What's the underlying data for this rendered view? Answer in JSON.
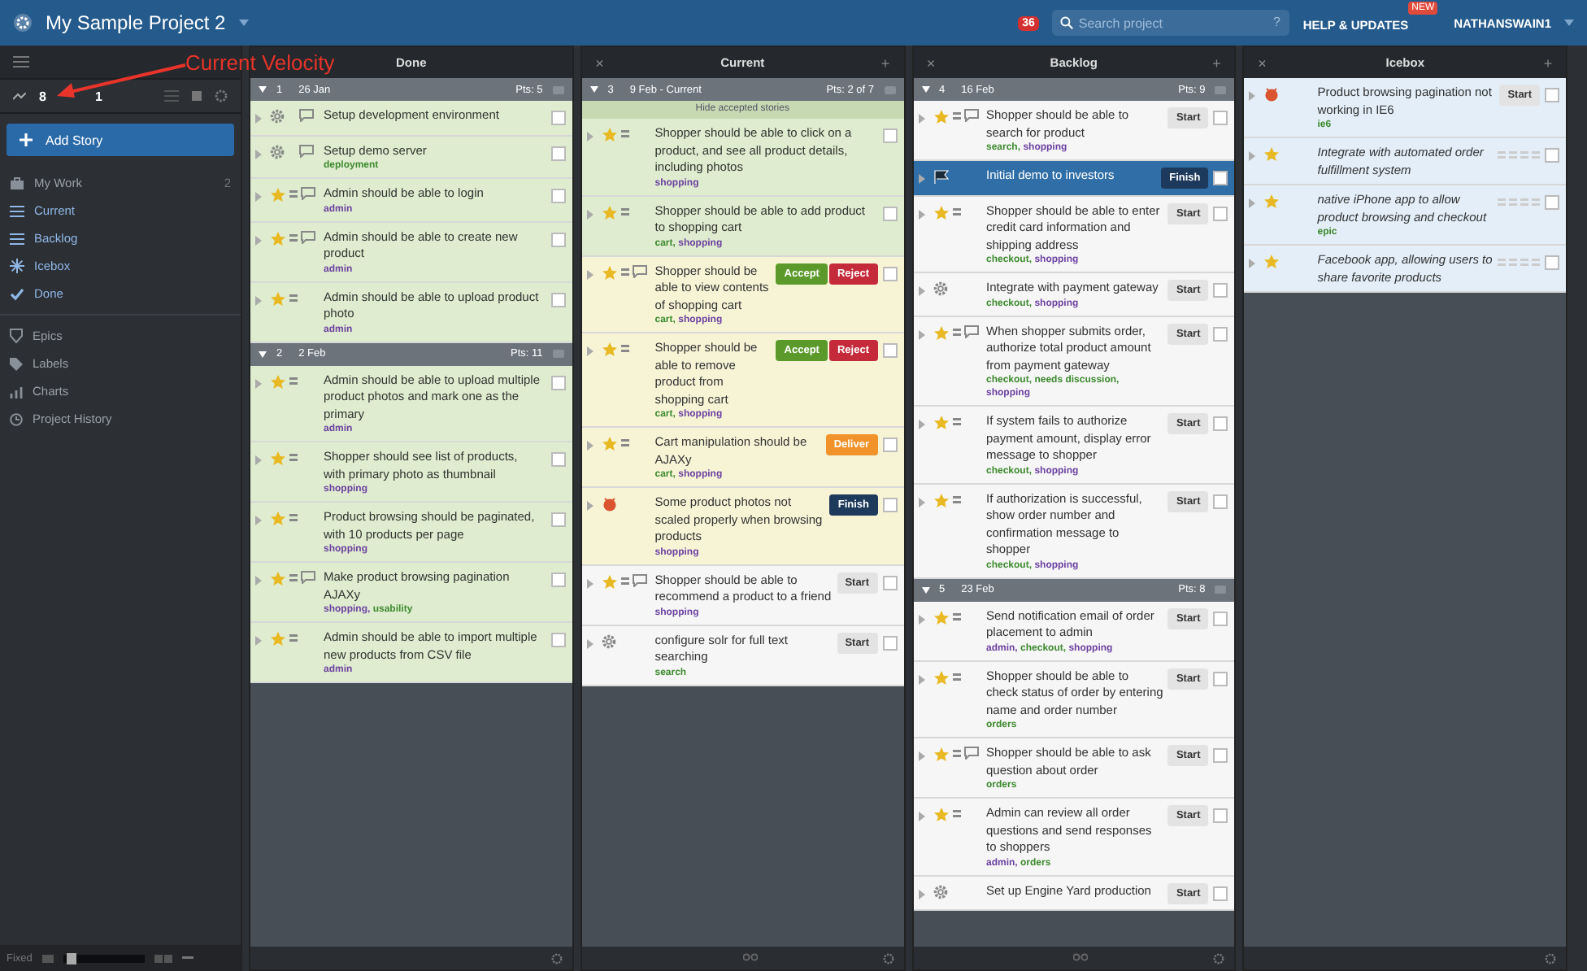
{
  "header": {
    "project": "My Sample Project 2",
    "notifications": "36",
    "search": {
      "placeholder": "Search project"
    },
    "help_key": "?",
    "help": "HELP & UPDATES",
    "help_badge": "NEW",
    "user": "NATHANSWAIN1"
  },
  "annotation": {
    "text": "Current Velocity"
  },
  "sidebar": {
    "velocity": "8",
    "velocity_2": "1",
    "add_story": "Add Story",
    "items": [
      {
        "label": "My Work",
        "count": "2",
        "open": false
      },
      {
        "label": "Current",
        "open": true
      },
      {
        "label": "Backlog",
        "open": true
      },
      {
        "label": "Icebox",
        "open": true
      },
      {
        "label": "Done",
        "open": true
      }
    ],
    "items_2": [
      {
        "label": "Epics"
      },
      {
        "label": "Labels"
      },
      {
        "label": "Charts"
      },
      {
        "label": "Project History"
      }
    ],
    "footer": {
      "mode": "Fixed",
      "zoom": {
        "level": 0.05
      }
    }
  },
  "columns": [
    {
      "title": "Done",
      "reorder": false,
      "groups": [
        {
          "number": "1",
          "date": "26 Jan",
          "points": "Pts: 5",
          "stories": [
            {
              "kind": "chore",
              "color": "#dfeccf",
              "comments": true,
              "title": "Setup development environment"
            },
            {
              "kind": "chore",
              "color": "#dfeccf",
              "comments": true,
              "title": "Setup demo server",
              "labels": [
                {
                  "name": "deployment",
                  "color": "#3d8b2f"
                }
              ]
            },
            {
              "kind": "feature",
              "estimated": true,
              "color": "#dfeccf",
              "comments": true,
              "title": "Admin should be able to login",
              "labels": [
                {
                  "name": "admin",
                  "color": "#6b3fa0"
                }
              ]
            },
            {
              "kind": "feature",
              "estimated": true,
              "color": "#dfeccf",
              "comments": true,
              "title": "Admin should be able to create new product",
              "labels": [
                {
                  "name": "admin",
                  "color": "#6b3fa0"
                }
              ]
            },
            {
              "kind": "feature",
              "estimated": true,
              "color": "#dfeccf",
              "comments": false,
              "title": "Admin should be able to upload product photo",
              "labels": [
                {
                  "name": "admin",
                  "color": "#6b3fa0"
                }
              ]
            }
          ]
        },
        {
          "number": "2",
          "date": "2 Feb",
          "points": "Pts: 11",
          "stories": [
            {
              "kind": "feature",
              "estimated": true,
              "color": "#dfeccf",
              "comments": false,
              "title": "Admin should be able to upload multiple product photos and mark one as the primary",
              "labels": [
                {
                  "name": "admin",
                  "color": "#6b3fa0"
                }
              ]
            },
            {
              "kind": "feature",
              "estimated": true,
              "color": "#dfeccf",
              "comments": false,
              "title": "Shopper should see list of products, with primary photo as thumbnail",
              "labels": [
                {
                  "name": "shopping",
                  "color": "#6b3fa0"
                }
              ]
            },
            {
              "kind": "feature",
              "estimated": true,
              "color": "#dfeccf",
              "comments": false,
              "title": "Product browsing should be paginated, with 10 products per page",
              "labels": [
                {
                  "name": "shopping",
                  "color": "#6b3fa0"
                }
              ]
            },
            {
              "kind": "feature",
              "estimated": true,
              "color": "#dfeccf",
              "comments": true,
              "title": "Make product browsing pagination AJAXy",
              "labels": [
                {
                  "name": "shopping,",
                  "color": "#6b3fa0"
                },
                {
                  "name": "usability",
                  "color": "#3d8b2f"
                }
              ]
            },
            {
              "kind": "feature",
              "estimated": true,
              "color": "#dfeccf",
              "comments": false,
              "title": "Admin should be able to import multiple new products from CSV file",
              "labels": [
                {
                  "name": "admin",
                  "color": "#6b3fa0"
                }
              ]
            }
          ]
        }
      ]
    },
    {
      "title": "Current",
      "close": "×",
      "add": "+",
      "reorder": true,
      "groups": [
        {
          "number": "3",
          "date": "9 Feb - Current",
          "points": "Pts: 2 of 7",
          "hide_accepted": "Hide accepted stories",
          "stories": [
            {
              "kind": "feature",
              "estimated": true,
              "color": "#dfeccf",
              "comments": false,
              "title": "Shopper should be able to click on a product, and see all product details, including photos",
              "labels": [
                {
                  "name": "shopping",
                  "color": "#6b3fa0"
                }
              ]
            },
            {
              "kind": "feature",
              "estimated": true,
              "color": "#dfeccf",
              "comments": false,
              "title": "Shopper should be able to add product to shopping cart",
              "labels": [
                {
                  "name": "cart,",
                  "color": "#3d8b2f"
                },
                {
                  "name": "shopping",
                  "color": "#6b3fa0"
                }
              ]
            },
            {
              "kind": "feature",
              "estimated": true,
              "color": "#f7f4d6",
              "comments": true,
              "title": "Shopper should be able to view contents of shopping cart",
              "labels": [
                {
                  "name": "cart,",
                  "color": "#3d8b2f"
                },
                {
                  "name": "shopping",
                  "color": "#6b3fa0"
                }
              ],
              "buttons": [
                {
                  "label": "Accept",
                  "kind": "accept"
                },
                {
                  "label": "Reject",
                  "kind": "reject"
                }
              ]
            },
            {
              "kind": "feature",
              "estimated": true,
              "color": "#f7f4d6",
              "comments": false,
              "title": "Shopper should be able to remove product from shopping cart",
              "labels": [
                {
                  "name": "cart,",
                  "color": "#3d8b2f"
                },
                {
                  "name": "shopping",
                  "color": "#6b3fa0"
                }
              ],
              "buttons": [
                {
                  "label": "Accept",
                  "kind": "accept"
                },
                {
                  "label": "Reject",
                  "kind": "reject"
                }
              ]
            },
            {
              "kind": "feature",
              "estimated": true,
              "color": "#f7f4d6",
              "comments": false,
              "title": "Cart manipulation should be AJAXy",
              "labels": [
                {
                  "name": "cart,",
                  "color": "#3d8b2f"
                },
                {
                  "name": "shopping",
                  "color": "#6b3fa0"
                }
              ],
              "buttons": [
                {
                  "label": "Deliver",
                  "kind": "deliver"
                }
              ]
            },
            {
              "kind": "bug",
              "color": "#f7f4d6",
              "comments": false,
              "title": "Some product photos not scaled properly when browsing products",
              "labels": [
                {
                  "name": "shopping",
                  "color": "#6b3fa0"
                }
              ],
              "buttons": [
                {
                  "label": "Finish",
                  "kind": "finish"
                }
              ]
            },
            {
              "kind": "feature",
              "estimated": true,
              "color": "#f6f6f6",
              "comments": true,
              "title": "Shopper should be able to recommend a product to a friend",
              "labels": [
                {
                  "name": "shopping",
                  "color": "#6b3fa0"
                }
              ],
              "buttons": [
                {
                  "label": "Start",
                  "kind": "start"
                }
              ]
            },
            {
              "kind": "chore",
              "color": "#f6f6f6",
              "comments": false,
              "title": "configure solr for full text searching",
              "labels": [
                {
                  "name": "search",
                  "color": "#3d8b2f"
                }
              ],
              "buttons": [
                {
                  "label": "Start",
                  "kind": "start"
                }
              ]
            }
          ]
        }
      ]
    },
    {
      "title": "Backlog",
      "close": "×",
      "add": "+",
      "reorder": true,
      "groups": [
        {
          "number": "4",
          "date": "16 Feb",
          "points": "Pts: 9",
          "stories": [
            {
              "kind": "feature",
              "estimated": true,
              "color": "#f6f6f6",
              "comments": true,
              "title": "Shopper should be able to search for product",
              "labels": [
                {
                  "name": "search,",
                  "color": "#3d8b2f"
                },
                {
                  "name": "shopping",
                  "color": "#6b3fa0"
                }
              ],
              "buttons": [
                {
                  "label": "Start",
                  "kind": "start"
                }
              ]
            },
            {
              "kind": "release",
              "color": "#2f6ea6",
              "comments": false,
              "title": "Initial demo to investors",
              "buttons": [
                {
                  "label": "Finish",
                  "kind": "finish"
                }
              ]
            },
            {
              "kind": "feature",
              "estimated": true,
              "color": "#f6f6f6",
              "comments": false,
              "title": "Shopper should be able to enter credit card information and shipping address",
              "labels": [
                {
                  "name": "checkout,",
                  "color": "#3d8b2f"
                },
                {
                  "name": "shopping",
                  "color": "#6b3fa0"
                }
              ],
              "buttons": [
                {
                  "label": "Start",
                  "kind": "start"
                }
              ]
            },
            {
              "kind": "chore",
              "color": "#f6f6f6",
              "comments": false,
              "title": "Integrate with payment gateway",
              "labels": [
                {
                  "name": "checkout,",
                  "color": "#3d8b2f"
                },
                {
                  "name": "shopping",
                  "color": "#6b3fa0"
                }
              ],
              "buttons": [
                {
                  "label": "Start",
                  "kind": "start"
                }
              ]
            },
            {
              "kind": "feature",
              "estimated": true,
              "color": "#f6f6f6",
              "comments": true,
              "title": "When shopper submits order, authorize total product amount from payment gateway",
              "labels": [
                {
                  "name": "checkout,",
                  "color": "#3d8b2f"
                },
                {
                  "name": "needs discussion,",
                  "color": "#3d8b2f"
                },
                {
                  "name": "shopping",
                  "color": "#6b3fa0"
                }
              ],
              "buttons": [
                {
                  "label": "Start",
                  "kind": "start"
                }
              ]
            },
            {
              "kind": "feature",
              "estimated": true,
              "color": "#f6f6f6",
              "comments": false,
              "title": "If system fails to authorize payment amount, display error message to shopper",
              "labels": [
                {
                  "name": "checkout,",
                  "color": "#3d8b2f"
                },
                {
                  "name": "shopping",
                  "color": "#6b3fa0"
                }
              ],
              "buttons": [
                {
                  "label": "Start",
                  "kind": "start"
                }
              ]
            },
            {
              "kind": "feature",
              "estimated": true,
              "color": "#f6f6f6",
              "comments": false,
              "title": "If authorization is successful, show order number and confirmation message to shopper",
              "labels": [
                {
                  "name": "checkout,",
                  "color": "#3d8b2f"
                },
                {
                  "name": "shopping",
                  "color": "#6b3fa0"
                }
              ],
              "buttons": [
                {
                  "label": "Start",
                  "kind": "start"
                }
              ]
            }
          ]
        },
        {
          "number": "5",
          "date": "23 Feb",
          "points": "Pts: 8",
          "stories": [
            {
              "kind": "feature",
              "estimated": true,
              "color": "#f6f6f6",
              "comments": false,
              "title": "Send notification email of order placement to admin",
              "labels": [
                {
                  "name": "admin,",
                  "color": "#6b3fa0"
                },
                {
                  "name": "checkout,",
                  "color": "#3d8b2f"
                },
                {
                  "name": "shopping",
                  "color": "#6b3fa0"
                }
              ],
              "buttons": [
                {
                  "label": "Start",
                  "kind": "start"
                }
              ]
            },
            {
              "kind": "feature",
              "estimated": true,
              "color": "#f6f6f6",
              "comments": false,
              "title": "Shopper should be able to check status of order by entering name and order number",
              "labels": [
                {
                  "name": "orders",
                  "color": "#3d8b2f"
                }
              ],
              "buttons": [
                {
                  "label": "Start",
                  "kind": "start"
                }
              ]
            },
            {
              "kind": "feature",
              "estimated": true,
              "color": "#f6f6f6",
              "comments": true,
              "title": "Shopper should be able to ask question about order",
              "labels": [
                {
                  "name": "orders",
                  "color": "#3d8b2f"
                }
              ],
              "buttons": [
                {
                  "label": "Start",
                  "kind": "start"
                }
              ]
            },
            {
              "kind": "feature",
              "estimated": true,
              "color": "#f6f6f6",
              "comments": false,
              "title": "Admin can review all order questions and send responses to shoppers",
              "labels": [
                {
                  "name": "admin,",
                  "color": "#6b3fa0"
                },
                {
                  "name": "orders",
                  "color": "#3d8b2f"
                }
              ],
              "buttons": [
                {
                  "label": "Start",
                  "kind": "start"
                }
              ]
            },
            {
              "kind": "chore",
              "color": "#f6f6f6",
              "comments": false,
              "title": "Set up Engine Yard production",
              "buttons": [
                {
                  "label": "Start",
                  "kind": "start"
                }
              ]
            }
          ]
        }
      ]
    },
    {
      "title": "Icebox",
      "close": "×",
      "add": "+",
      "reorder": false,
      "groups": [
        {
          "stories": [
            {
              "kind": "bug",
              "color": "#e3eef8",
              "comments": false,
              "title": "Product browsing pagination not working in IE6",
              "labels": [
                {
                  "name": "ie6",
                  "color": "#3d8b2f"
                }
              ],
              "buttons": [
                {
                  "label": "Start",
                  "kind": "start"
                }
              ]
            },
            {
              "kind": "feature",
              "estimated": false,
              "color": "#e3eef8",
              "comments": false,
              "title": "Integrate with automated order fulfillment system"
            },
            {
              "kind": "feature",
              "estimated": false,
              "color": "#e3eef8",
              "comments": false,
              "title": "native iPhone app to allow product browsing and checkout",
              "labels": [
                {
                  "name": "epic",
                  "color": "#3d8b2f"
                }
              ]
            },
            {
              "kind": "feature",
              "estimated": false,
              "color": "#e3eef8",
              "comments": false,
              "title": "Facebook app, allowing users to share favorite products"
            }
          ]
        }
      ]
    }
  ]
}
